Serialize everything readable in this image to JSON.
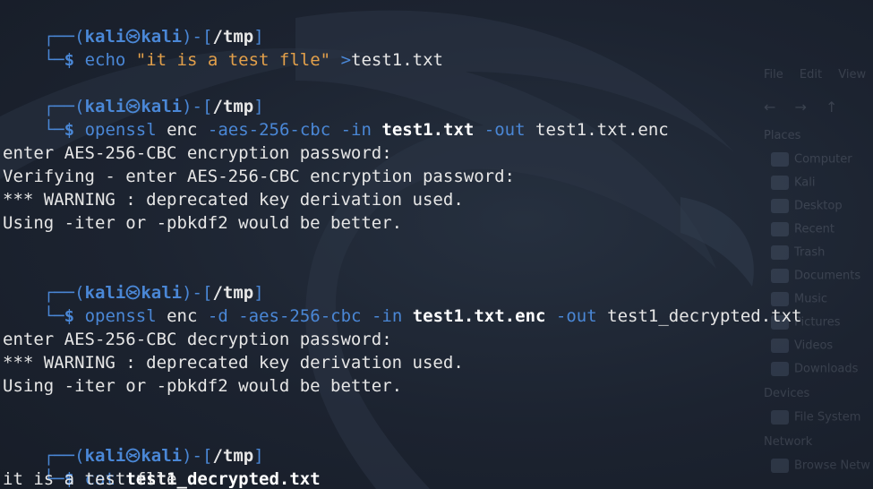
{
  "prompt": {
    "open_paren": "(",
    "user": "kali",
    "host": "kali",
    "close_paren": ")",
    "dash": "-",
    "open_bracket": "[",
    "dir": "/tmp",
    "close_bracket": "]",
    "dollar": "$",
    "icon": "kali-dragon-icon"
  },
  "blocks": [
    {
      "command": {
        "program": "echo",
        "arg1": "\"it is a test flle\"",
        "redirect": ">",
        "target": "test1.txt"
      },
      "output": []
    },
    {
      "command": {
        "program": "openssl",
        "seg1": "enc",
        "seg2": "-aes-256-cbc",
        "seg3": "-in",
        "seg4": "test1.txt",
        "seg5": "-out",
        "seg6": "test1.txt.enc"
      },
      "output": [
        "enter AES-256-CBC encryption password:",
        "Verifying - enter AES-256-CBC encryption password:",
        "*** WARNING : deprecated key derivation used.",
        "Using -iter or -pbkdf2 would be better."
      ]
    },
    {
      "command": {
        "program": "openssl",
        "seg1": "enc",
        "seg2": "-d",
        "seg3": "-aes-256-cbc",
        "seg4": "-in",
        "seg5": "test1.txt.enc",
        "seg6": "-out",
        "seg7": "test1_decrypted.txt"
      },
      "output": [
        "enter AES-256-CBC decryption password:",
        "*** WARNING : deprecated key derivation used.",
        "Using -iter or -pbkdf2 would be better."
      ]
    },
    {
      "command": {
        "program": "cat",
        "arg1": "test1_decrypted.txt"
      },
      "output": [
        "it is a test flle"
      ]
    }
  ],
  "background_file_manager": {
    "menu": [
      "File",
      "Edit",
      "View"
    ],
    "sections": {
      "places": "Places",
      "devices": "Devices",
      "network": "Network"
    },
    "places_items": [
      "Computer",
      "Kali",
      "Desktop",
      "Recent",
      "Trash",
      "Documents",
      "Music",
      "Pictures",
      "Videos",
      "Downloads"
    ],
    "devices_items": [
      "File System"
    ],
    "network_items": [
      "Browse Netw"
    ]
  },
  "colors": {
    "background": "#1b2230",
    "prompt_blue": "#4a87d6",
    "string_orange": "#e3a04a",
    "text": "#e6e6e6"
  }
}
